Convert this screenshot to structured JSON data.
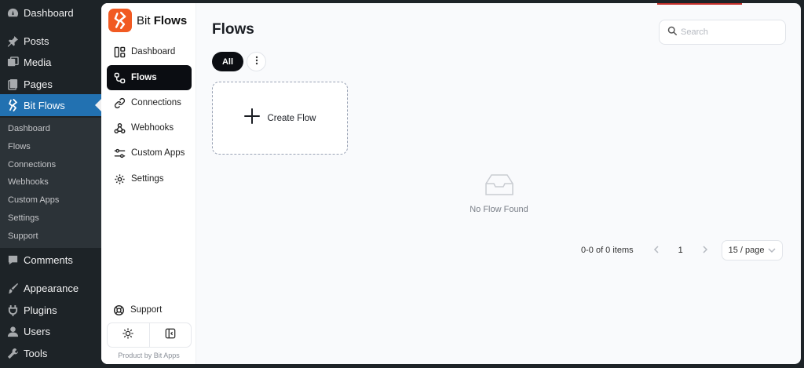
{
  "wp_sidebar": {
    "items": [
      {
        "label": "Dashboard",
        "icon": "dashboard-icon"
      },
      {
        "label": "Posts",
        "icon": "pin-icon"
      },
      {
        "label": "Media",
        "icon": "media-icon"
      },
      {
        "label": "Pages",
        "icon": "pages-icon"
      },
      {
        "label": "Bit Flows",
        "icon": "bit-flows-icon"
      },
      {
        "label": "Comments",
        "icon": "comment-icon"
      },
      {
        "label": "Appearance",
        "icon": "brush-icon"
      },
      {
        "label": "Plugins",
        "icon": "plug-icon"
      },
      {
        "label": "Users",
        "icon": "user-icon"
      },
      {
        "label": "Tools",
        "icon": "wrench-icon"
      }
    ],
    "submenu": [
      "Dashboard",
      "Flows",
      "Connections",
      "Webhooks",
      "Custom Apps",
      "Settings",
      "Support"
    ]
  },
  "app": {
    "brand_light": "Bit",
    "brand_bold": "Flows",
    "brand_color": "#f15a22",
    "nav": [
      {
        "label": "Dashboard",
        "icon": "layout-icon"
      },
      {
        "label": "Flows",
        "icon": "flow-icon"
      },
      {
        "label": "Connections",
        "icon": "link-icon"
      },
      {
        "label": "Webhooks",
        "icon": "webhook-icon"
      },
      {
        "label": "Custom Apps",
        "icon": "sliders-icon"
      },
      {
        "label": "Settings",
        "icon": "gear-icon"
      }
    ],
    "active_nav": "Flows",
    "support_label": "Support",
    "credit": "Product by Bit Apps"
  },
  "main": {
    "title": "Flows",
    "search_placeholder": "Search",
    "filter_all": "All",
    "create_label": "Create Flow",
    "empty_label": "No Flow Found",
    "pagination": {
      "summary": "0-0 of 0 items",
      "current_page": "1",
      "page_size": "15 / page"
    }
  }
}
